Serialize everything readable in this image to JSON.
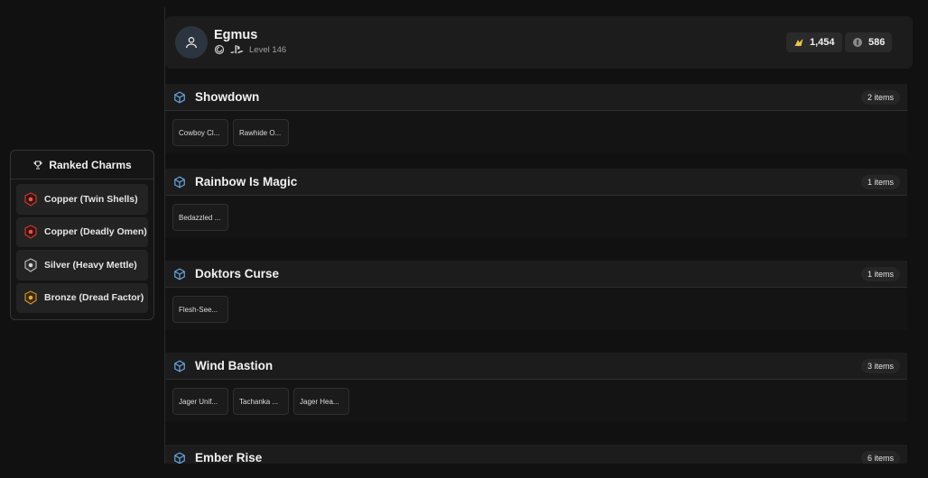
{
  "ranked_charms": {
    "title": "Ranked Charms",
    "items": [
      {
        "label": "Copper (Twin Shells)",
        "icon": "copper-charm-icon",
        "color": "#c0392b"
      },
      {
        "label": "Copper (Deadly Omen)",
        "icon": "copper-charm-icon",
        "color": "#c0392b"
      },
      {
        "label": "Silver (Heavy Mettle)",
        "icon": "silver-charm-icon",
        "color": "#b8b8b8"
      },
      {
        "label": "Bronze (Dread Factor)",
        "icon": "bronze-charm-icon",
        "color": "#c98a2e"
      }
    ]
  },
  "profile": {
    "name": "Egmus",
    "level": "Level 146",
    "renown": "1,454",
    "credits": "586"
  },
  "collections": [
    {
      "title": "Showdown",
      "count": "2 items",
      "items": [
        "Cowboy Cl...",
        "Rawhide O..."
      ]
    },
    {
      "title": "Rainbow Is Magic",
      "count": "1 items",
      "items": [
        "Bedazzled ..."
      ]
    },
    {
      "title": "Doktors Curse",
      "count": "1 items",
      "items": [
        "Flesh-See..."
      ]
    },
    {
      "title": "Wind Bastion",
      "count": "3 items",
      "items": [
        "Jager Unif...",
        "Tachanka ...",
        "Jager Hea..."
      ]
    },
    {
      "title": "Ember Rise",
      "count": "6 items",
      "items": []
    }
  ],
  "colors": {
    "accent_icon": "#6aa8e8",
    "renown_icon": "#e8c54a"
  }
}
